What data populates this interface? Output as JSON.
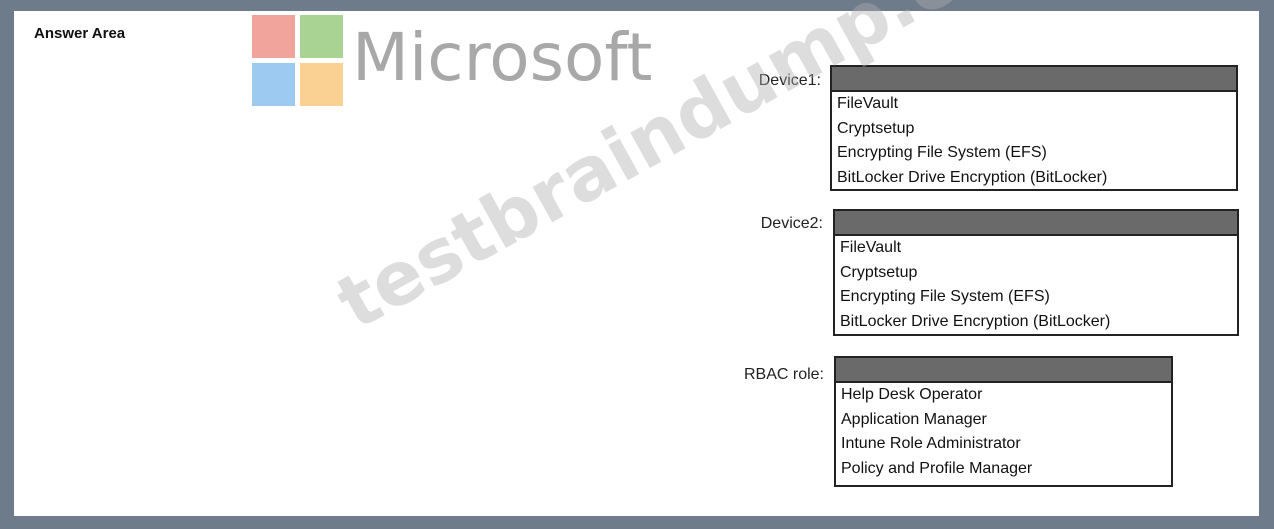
{
  "answer_area": {
    "title": "Answer Area"
  },
  "logo": {
    "text": "Microsoft"
  },
  "watermark": {
    "text": "testbraindump.com"
  },
  "dropdowns": [
    {
      "label": "Device1:",
      "options": [
        "FileVault",
        "Cryptsetup",
        "Encrypting File System (EFS)",
        "BitLocker Drive Encryption (BitLocker)"
      ]
    },
    {
      "label": "Device2:",
      "options": [
        "FileVault",
        "Cryptsetup",
        "Encrypting File System (EFS)",
        "BitLocker Drive Encryption (BitLocker)"
      ]
    },
    {
      "label": "RBAC role:",
      "options": [
        "Help Desk Operator",
        "Application Manager",
        "Intune Role Administrator",
        "Policy and Profile Manager"
      ]
    }
  ],
  "colors": {
    "frame": "#6e7b8b",
    "dropdown_header": "#6a6a6a"
  }
}
